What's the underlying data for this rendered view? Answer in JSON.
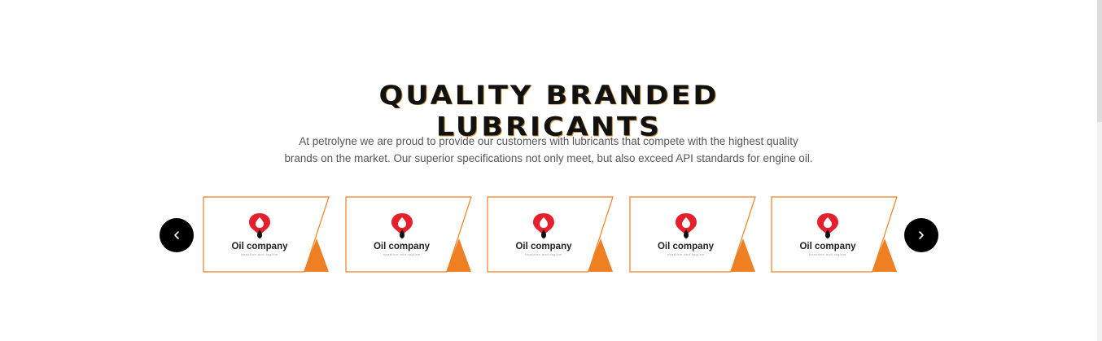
{
  "section": {
    "heading_line1": "QUALITY BRANDED",
    "heading_line2": "LUBRICANTS",
    "description_line1": "At petrolyne we are proud to provide our customers with lubricants that compete with the highest quality",
    "description_line2": "brands on the market. Our superior specifications not only meet, but also exceed API standards for engine oil."
  },
  "carousel": {
    "prev_icon": "chevron-left-icon",
    "next_icon": "chevron-right-icon",
    "cards": [
      {
        "name": "Oil company",
        "tagline": "headline and tagline",
        "icon": "oil-drop-icon"
      },
      {
        "name": "Oil company",
        "tagline": "headline and tagline",
        "icon": "oil-drop-icon"
      },
      {
        "name": "Oil company",
        "tagline": "headline and tagline",
        "icon": "oil-drop-icon"
      },
      {
        "name": "Oil company",
        "tagline": "headline and tagline",
        "icon": "oil-drop-icon"
      },
      {
        "name": "Oil company",
        "tagline": "headline and tagline",
        "icon": "oil-drop-icon"
      }
    ]
  },
  "colors": {
    "accent": "#ee7f22",
    "logo_red": "#e4202c",
    "button_bg": "#000000",
    "heading": "#111111"
  }
}
